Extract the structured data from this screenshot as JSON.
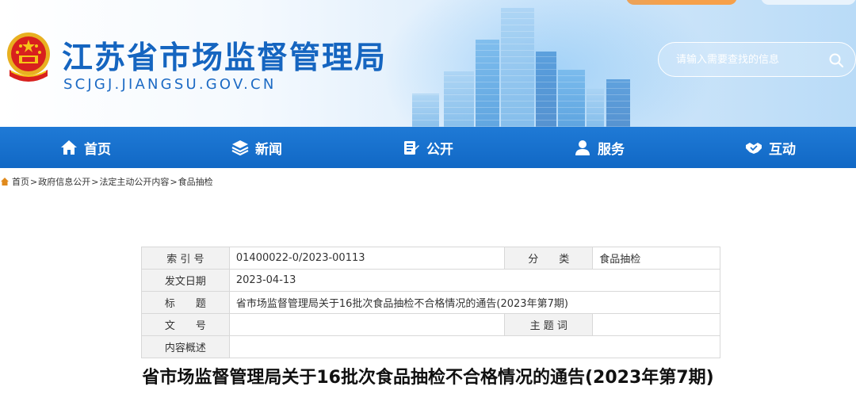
{
  "header": {
    "site_title": "江苏省市场监督管理局",
    "site_domain": "SCJGJ.JIANGSU.GOV.CN",
    "search_placeholder": "请输入需要查找的信息"
  },
  "nav": {
    "items": [
      {
        "label": "首页",
        "icon": "home-icon"
      },
      {
        "label": "新闻",
        "icon": "layers-icon"
      },
      {
        "label": "公开",
        "icon": "document-stack-icon"
      },
      {
        "label": "服务",
        "icon": "users-icon"
      },
      {
        "label": "互动",
        "icon": "handshake-icon"
      }
    ]
  },
  "breadcrumb": {
    "items": [
      "首页",
      "政府信息公开",
      "法定主动公开内容",
      "食品抽检"
    ],
    "separator": ">"
  },
  "info": {
    "index_label": "索 引 号",
    "index_value": "01400022-0/2023-00113",
    "category_label": "分　　类",
    "category_value": "食品抽检",
    "date_label": "发文日期",
    "date_value": "2023-04-13",
    "title_label": "标　　题",
    "title_value": "省市场监督管理局关于16批次食品抽检不合格情况的通告(2023年第7期)",
    "doc_no_label": "文　　号",
    "doc_no_value": "",
    "keywords_label": "主 题 词",
    "keywords_value": "",
    "summary_label": "内容概述",
    "summary_value": ""
  },
  "article": {
    "title": "省市场监督管理局关于16批次食品抽检不合格情况的通告(2023年第7期)"
  },
  "colors": {
    "brand_blue": "#1565c0",
    "nav_blue": "#1a72cf",
    "accent_orange": "#f39a3c"
  }
}
